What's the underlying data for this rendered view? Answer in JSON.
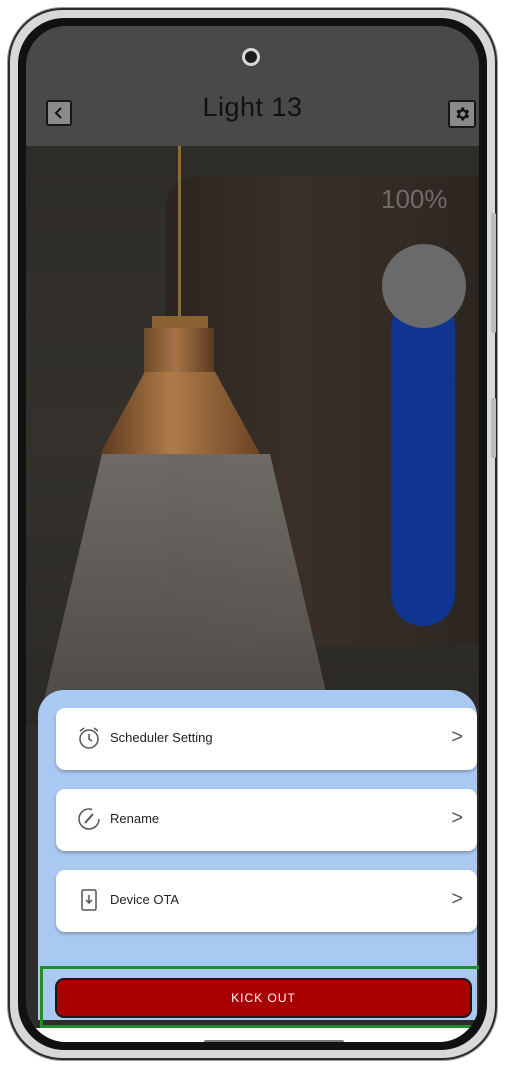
{
  "header": {
    "title": "Light 13",
    "back_icon": "chevron-left-icon",
    "settings_icon": "gear-icon"
  },
  "brightness": {
    "label": "100%",
    "level": 1.0,
    "track_color": "#0f3590"
  },
  "menu": {
    "items": [
      {
        "label": "Scheduler Setting",
        "icon": "alarm-clock-icon"
      },
      {
        "label": "Rename",
        "icon": "pencil-icon"
      },
      {
        "label": "Device OTA",
        "icon": "download-icon"
      }
    ],
    "chevron": ">"
  },
  "kick_out": {
    "label": "KICK OUT",
    "color": "#a80000",
    "highlight_color": "#1f8f2a"
  },
  "colors": {
    "sheet_bg": "#a9c8f2",
    "header_bg": "#4b4947"
  }
}
